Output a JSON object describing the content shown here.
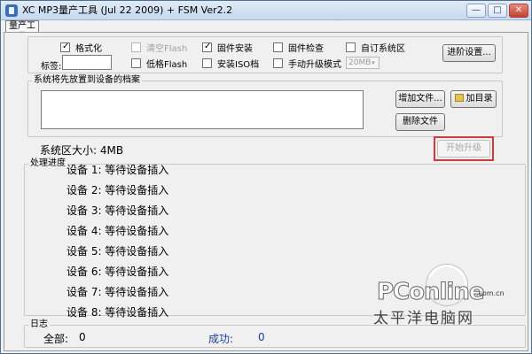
{
  "window": {
    "title": "XC MP3量产工具 (Jul 22 2009) + FSM Ver2.2",
    "min_glyph": "—",
    "max_glyph": "□",
    "close_glyph": "✕"
  },
  "tab": {
    "label": "量产工具"
  },
  "options": {
    "format": {
      "label": "格式化",
      "checked": true
    },
    "clear_flash": {
      "label": "清空Flash",
      "checked": false,
      "disabled": true
    },
    "firmware_install": {
      "label": "固件安装",
      "checked": true
    },
    "firmware_check": {
      "label": "固件检查",
      "checked": false
    },
    "custom_system_area": {
      "label": "自订系统区",
      "checked": false
    },
    "label_field": {
      "label": "标签:",
      "value": ""
    },
    "low_format": {
      "label": "低格Flash",
      "checked": false
    },
    "install_iso": {
      "label": "安装ISO档",
      "checked": false
    },
    "manual_upgrade": {
      "label": "手动升级模式",
      "checked": false
    },
    "size_select": {
      "value": "20MB",
      "arrow": "▾"
    },
    "advanced_button": "进阶设置..."
  },
  "files": {
    "group_title": "系统将先放置到设备的档案",
    "add_file_button": "增加文件...",
    "add_dir_button": "加目录",
    "delete_file_button": "删除文件"
  },
  "system_area": {
    "text": "系统区大小: 4MB"
  },
  "start_button": "开始升级",
  "progress": {
    "group_title": "处理进度",
    "devices": [
      "设备 1:  等待设备插入",
      "设备 2:  等待设备插入",
      "设备 3:  等待设备插入",
      "设备 4:  等待设备插入",
      "设备 5:  等待设备插入",
      "设备 6:  等待设备插入",
      "设备 7:  等待设备插入",
      "设备 8:  等待设备插入"
    ]
  },
  "log": {
    "group_title": "日志",
    "total_label": "全部:",
    "total_value": "0",
    "success_label": "成功:",
    "success_value": "0",
    "success_color": "#1a3ea0"
  },
  "watermark": {
    "brand": "PConline",
    "domain": ".com.cn",
    "cn": "太平洋电脑网"
  }
}
